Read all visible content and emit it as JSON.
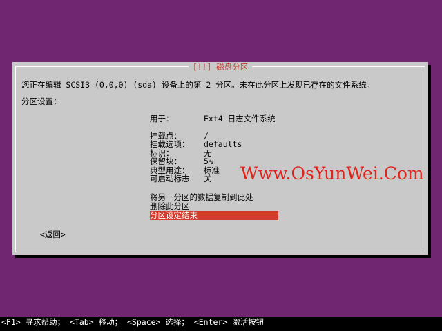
{
  "dialog": {
    "title": "[!!] 磁盘分区",
    "description": "您正在编辑 SCSI3 (0,0,0) (sda) 设备上的第 2 分区。未在此分区上发现已存在的文件系统。",
    "settings_heading": "分区设置：",
    "settings": [
      {
        "label": "用于：",
        "value": "Ext4 日志文件系统"
      },
      {
        "label": "挂载点：",
        "value": "/"
      },
      {
        "label": "挂载选项：",
        "value": "defaults"
      },
      {
        "label": "标识：",
        "value": "无"
      },
      {
        "label": "保留块：",
        "value": "5%"
      },
      {
        "label": "典型用途：",
        "value": "标准"
      },
      {
        "label": "可启动标志",
        "value": "关"
      }
    ],
    "actions": [
      {
        "label": "将另一分区的数据复制到此处"
      },
      {
        "label": "删除此分区"
      },
      {
        "label": "分区设定结束"
      }
    ],
    "back_label": "<返回>"
  },
  "watermark": "Www.OsYunWei.Com",
  "footer": {
    "help": "<F1> 寻求帮助； <Tab> 移动； <Space> 选择； <Enter> 激活按钮"
  },
  "colors": {
    "background": "#712672",
    "dialog": "#c9c9c9",
    "title": "#c8402e",
    "selection": "#d33c2c",
    "watermark": "#e0241b"
  }
}
